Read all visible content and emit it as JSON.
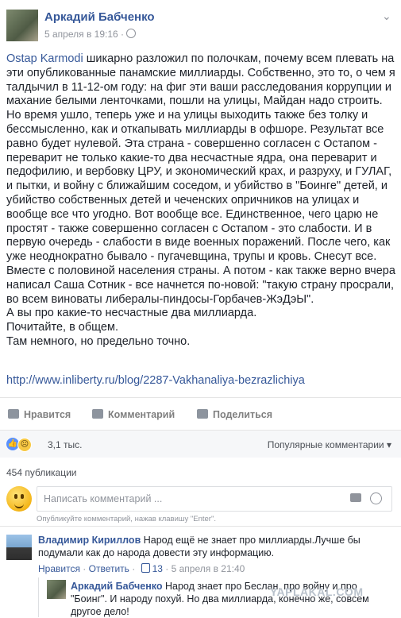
{
  "post": {
    "author": "Аркадий Бабченко",
    "timestamp": "5 апреля в 19:16 ·",
    "mention": "Ostap Karmodi",
    "paragraphs": [
      " шикарно разложил по полочкам, почему всем плевать на эти опубликованные панамские миллиарды. Собственно, это то, о чем я талдычил в 11-12-ом году: на фиг эти ваши расследования коррупции и махание белыми ленточками, пошли на улицы, Майдан надо строить. Но время ушло, теперь уже и на улицы выходить также без толку и бессмысленно, как и откапывать миллиарды в офшоре. Результат все равно будет нулевой. Эта страна - совершенно согласен с Остапом - переварит не только какие-то два несчастные ядра, она переварит и педофилию, и вербовку ЦРУ, и экономический крах, и разруху, и ГУЛАГ, и пытки, и войну с ближайшим соседом, и убийство в \"Боинге\" детей, и убийство собственных детей и чеченских опричников на улицах и вообще все что угодно. Вот вообще все. Единственное, чего царю не простят - также совершенно согласен с Остапом - это слабости. И в первую очередь - слабости в виде военных поражений. После чего, как уже неоднократно бывало - пугачевщина, трупы и кровь. Снесут все. Вместе с половиной населения страны. А потом - как также верно вчера написал Саша Сотник - все начнется по-новой: \"такую страну просрали, во всем виноваты либералы-пиндосы-Горбачев-ЖэДэЫ\".",
      "А вы про какие-то несчастные два миллиарда.",
      "Почитайте, в общем.",
      "Там немного, но предельно точно."
    ],
    "link": "http://www.inliberty.ru/blog/2287-Vakhanaliya-bezrazlichiya"
  },
  "actions": {
    "like": "Нравится",
    "comment": "Комментарий",
    "share": "Поделиться"
  },
  "reactions": {
    "count": "3,1 тыс.",
    "sort_label": "Популярные комментарии ▾"
  },
  "publications": "454 публикации",
  "composer": {
    "placeholder": "Написать комментарий ...",
    "hint": "Опубликуйте комментарий, нажав клавишу \"Enter\"."
  },
  "comments": [
    {
      "author": "Владимир Кириллов",
      "text": "Народ ещё не знает про миллиарды.Лучше бы подумали как до народа довести эту информацию.",
      "like": "Нравится",
      "reply": "Ответить",
      "likes": "13",
      "time": "5 апреля в 21:40"
    }
  ],
  "reply": {
    "author": "Аркадий Бабченко",
    "text": "Народ знает про Беслан, про войну и про \"Боинг\". И народу похуй. Но два миллиарда, конечно же, совсем другое дело!"
  },
  "watermark": "YAPLAKAL.COM",
  "colors": {
    "link": "#365899",
    "like_blue": "#5890ff",
    "muted": "#90949c"
  }
}
